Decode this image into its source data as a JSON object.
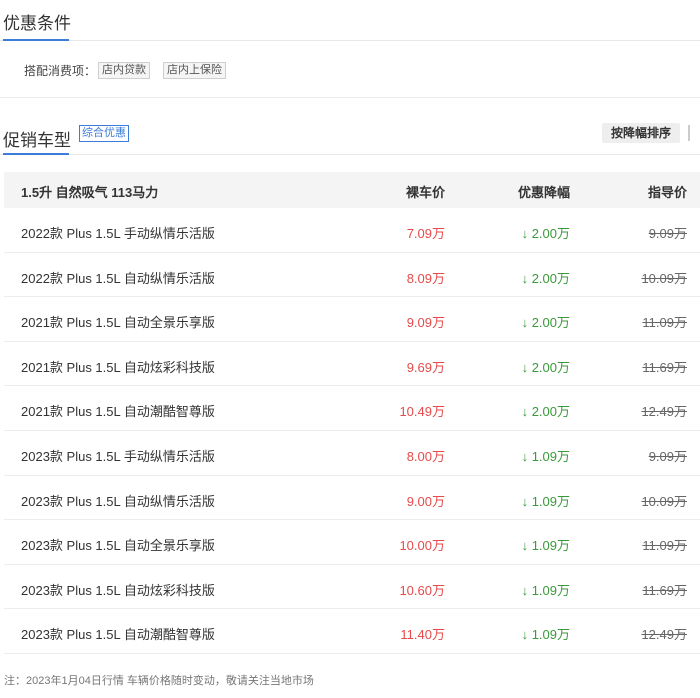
{
  "conditions": {
    "title": "优惠条件",
    "label": "搭配消费项：",
    "tags": [
      "店内贷款",
      "店内上保险"
    ]
  },
  "promo": {
    "title": "促销车型",
    "badge": "综合优惠",
    "sort_label": "按降幅排序"
  },
  "table": {
    "headers": {
      "engine": "1.5升 自然吸气 113马力",
      "price": "裸车价",
      "discount": "优惠降幅",
      "guide": "指导价"
    },
    "rows": [
      {
        "name": "2022款 Plus 1.5L 手动纵情乐活版",
        "price": "7.09万",
        "discount": "↓ 2.00万",
        "guide": "9.09万"
      },
      {
        "name": "2022款 Plus 1.5L 自动纵情乐活版",
        "price": "8.09万",
        "discount": "↓ 2.00万",
        "guide": "10.09万"
      },
      {
        "name": "2021款 Plus 1.5L 自动全景乐享版",
        "price": "9.09万",
        "discount": "↓ 2.00万",
        "guide": "11.09万"
      },
      {
        "name": "2021款 Plus 1.5L 自动炫彩科技版",
        "price": "9.69万",
        "discount": "↓ 2.00万",
        "guide": "11.69万"
      },
      {
        "name": "2021款 Plus 1.5L 自动潮酷智尊版",
        "price": "10.49万",
        "discount": "↓ 2.00万",
        "guide": "12.49万"
      },
      {
        "name": "2023款 Plus 1.5L 手动纵情乐活版",
        "price": "8.00万",
        "discount": "↓ 1.09万",
        "guide": "9.09万"
      },
      {
        "name": "2023款 Plus 1.5L 自动纵情乐活版",
        "price": "9.00万",
        "discount": "↓ 1.09万",
        "guide": "10.09万"
      },
      {
        "name": "2023款 Plus 1.5L 自动全景乐享版",
        "price": "10.00万",
        "discount": "↓ 1.09万",
        "guide": "11.09万"
      },
      {
        "name": "2023款 Plus 1.5L 自动炫彩科技版",
        "price": "10.60万",
        "discount": "↓ 1.09万",
        "guide": "11.69万"
      },
      {
        "name": "2023款 Plus 1.5L 自动潮酷智尊版",
        "price": "11.40万",
        "discount": "↓ 1.09万",
        "guide": "12.49万"
      }
    ]
  },
  "note": "注：2023年1月04日行情 车辆价格随时变动，敬请关注当地市场",
  "colors": {
    "accent": "#3b7dd8",
    "price": "#e64a4a",
    "discount": "#3a9a3a"
  }
}
